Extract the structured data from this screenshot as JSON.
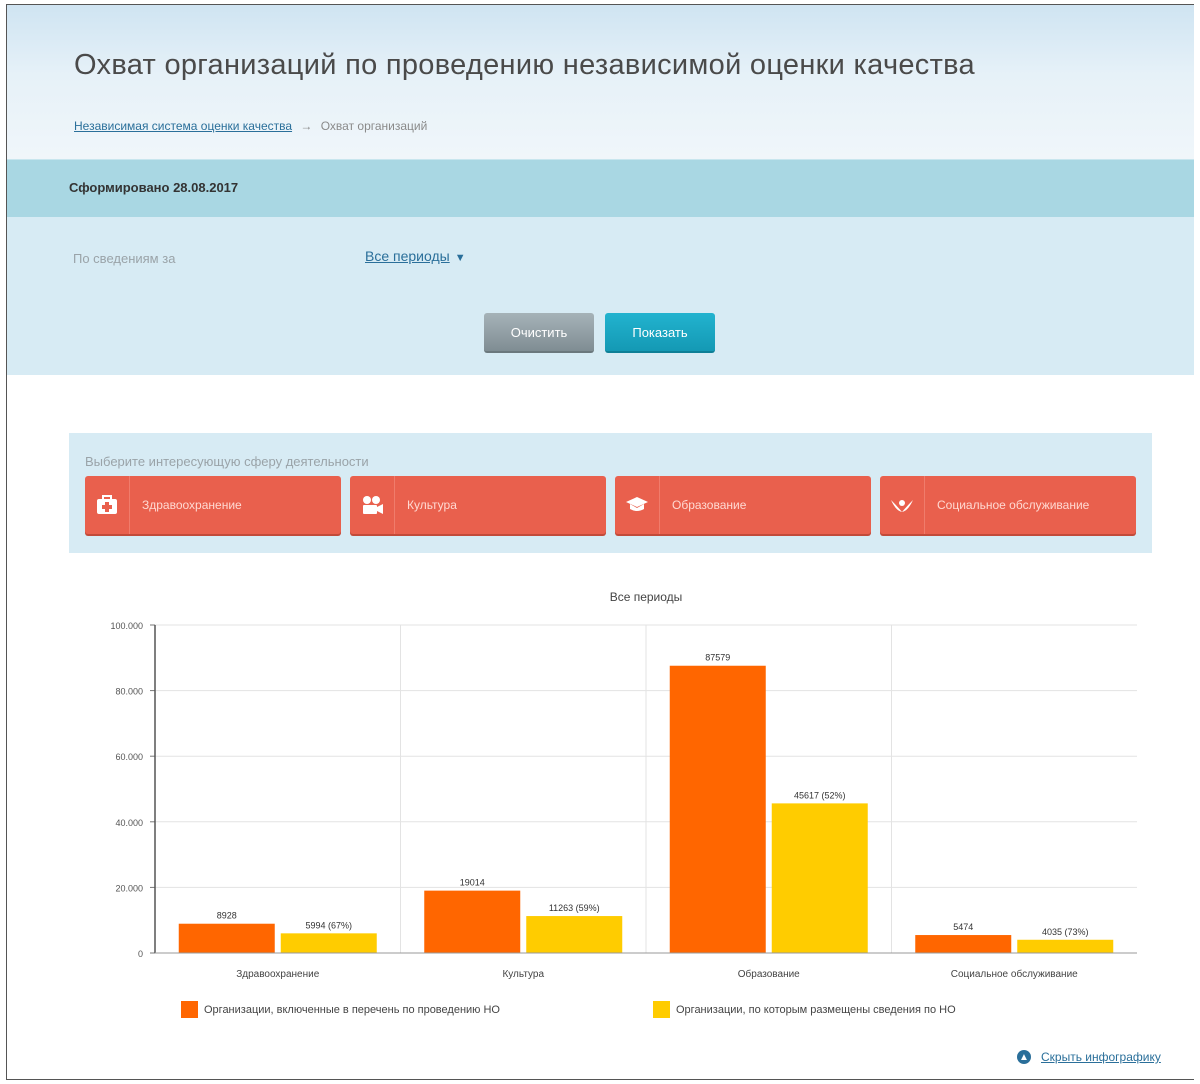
{
  "header": {
    "title": "Охват организаций по проведению независимой оценки качества",
    "breadcrumb": {
      "link": "Независимая система оценки качества",
      "separator": "→",
      "current": "Охват организаций"
    }
  },
  "status": {
    "generated": "Сформировано 28.08.2017"
  },
  "filter": {
    "label": "По сведениям за",
    "period_value": "Все периоды",
    "clear_label": "Очистить",
    "show_label": "Показать"
  },
  "spheres": {
    "title": "Выберите интересующую сферу деятельности",
    "items": [
      {
        "label": "Здравоохранение",
        "icon": "medical-kit-icon"
      },
      {
        "label": "Культура",
        "icon": "film-camera-icon"
      },
      {
        "label": "Образование",
        "icon": "graduation-cap-icon"
      },
      {
        "label": "Социальное обслуживание",
        "icon": "hands-heart-icon"
      }
    ]
  },
  "chart_data": {
    "type": "bar",
    "title": "Все периоды",
    "categories": [
      "Здравоохранение",
      "Культура",
      "Образование",
      "Социальное обслуживание"
    ],
    "series": [
      {
        "name": "Организации, включенные в перечень по проведению НО",
        "color": "#ff6600",
        "values": [
          8928,
          19014,
          87579,
          5474
        ],
        "labels": [
          "8928",
          "19014",
          "87579",
          "5474"
        ]
      },
      {
        "name": "Организации, по которым размещены сведения по НО",
        "color": "#ffcc00",
        "values": [
          5994,
          11263,
          45617,
          4035
        ],
        "labels": [
          "5994 (67%)",
          "11263 (59%)",
          "45617 (52%)",
          "4035 (73%)"
        ]
      }
    ],
    "ylim": [
      0,
      100000
    ],
    "yticks": [
      0,
      20000,
      40000,
      60000,
      80000,
      100000
    ],
    "ytick_labels": [
      "0",
      "20.000",
      "40.000",
      "60.000",
      "80.000",
      "100.000"
    ],
    "grid": true,
    "legend_position": "bottom"
  },
  "footer": {
    "toggle_label": "Скрыть инфографику"
  }
}
